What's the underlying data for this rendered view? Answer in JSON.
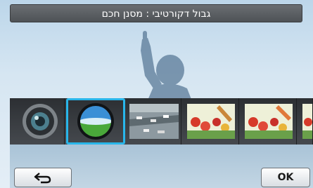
{
  "header": {
    "title": "גבול דקורטיבי : מסנן חכם"
  },
  "filters": [
    {
      "icon": "camera-lens-icon"
    },
    {
      "icon": "fisheye-icon"
    },
    {
      "icon": "miniature-icon"
    },
    {
      "icon": "painting-icon"
    },
    {
      "icon": "painting-icon"
    },
    {
      "icon": "painting-icon"
    }
  ],
  "footer": {
    "back_icon": "back-arrow-icon",
    "ok_label": "OK"
  },
  "colors": {
    "accent": "#29b6ea",
    "title_bg": "#5a5e62"
  }
}
